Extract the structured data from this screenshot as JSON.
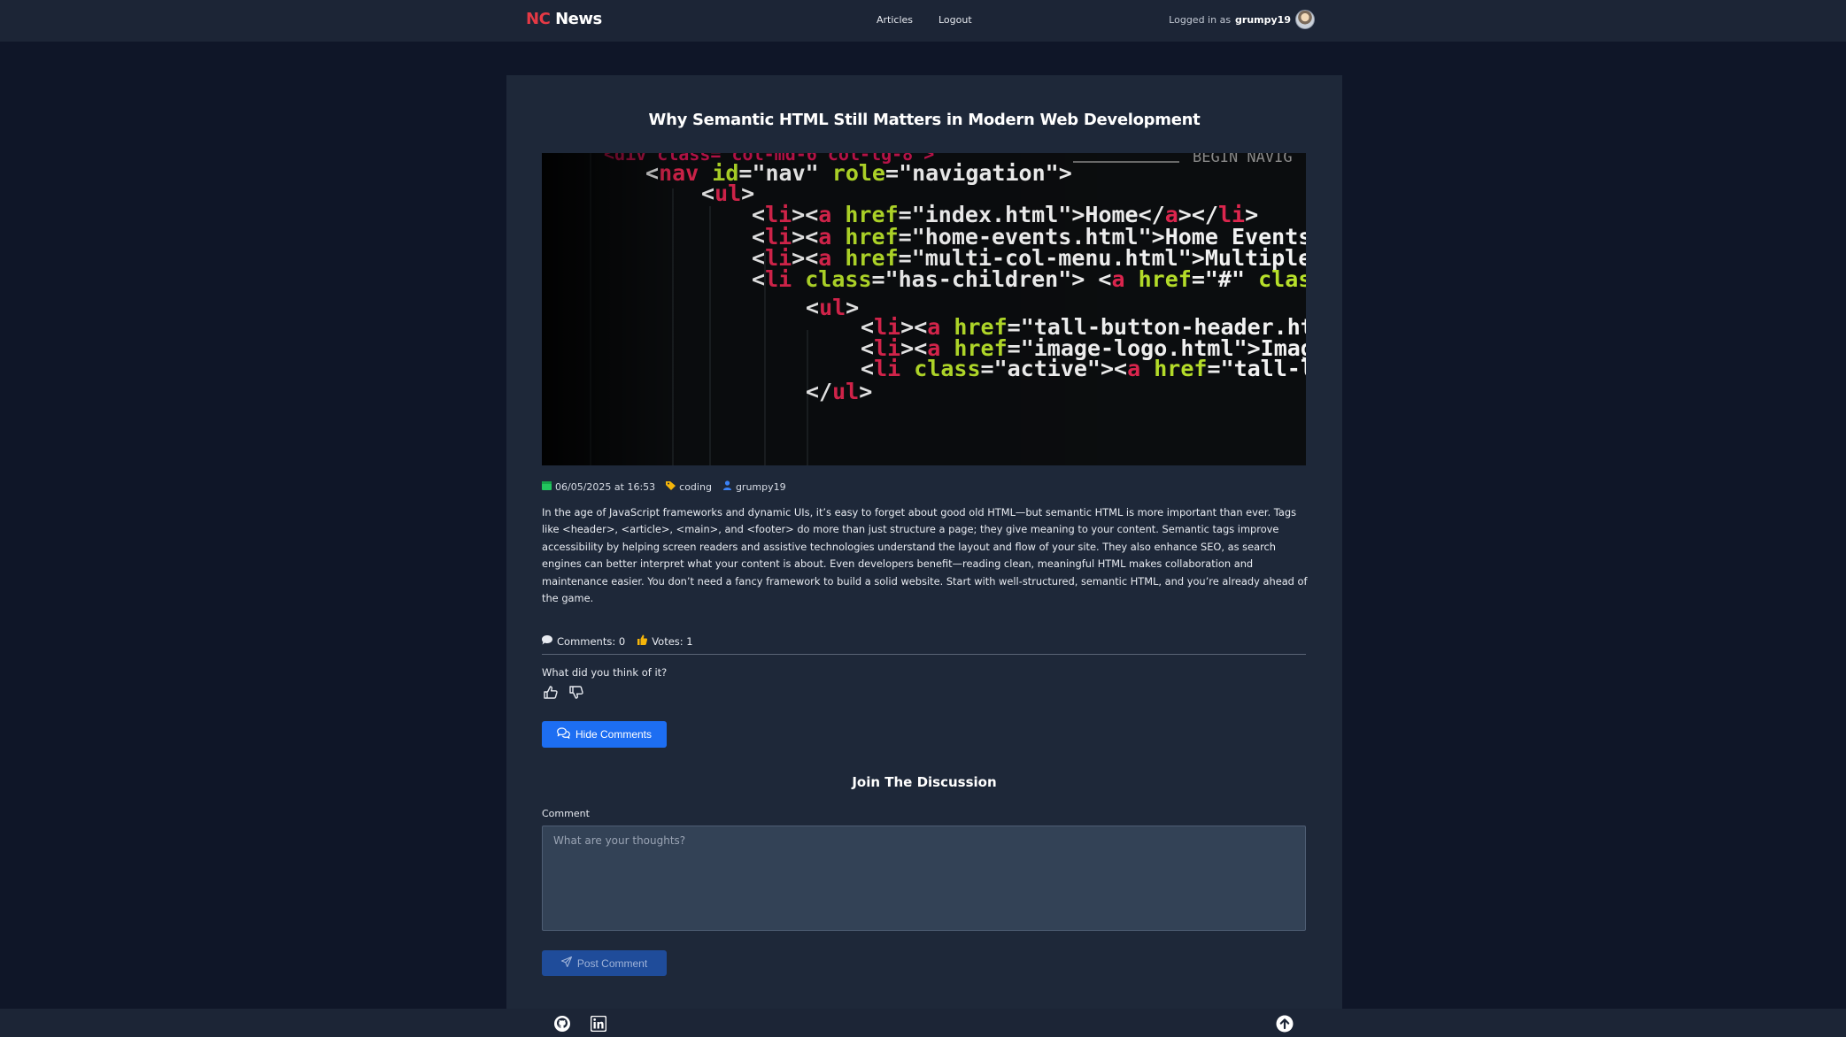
{
  "header": {
    "logo_nc": "NC",
    "logo_news": "News",
    "nav": {
      "articles": "Articles",
      "logout": "Logout"
    },
    "logged_prefix": "Logged in as",
    "username": "grumpy19",
    "avatar_icon": "user-avatar"
  },
  "article": {
    "title": "Why Semantic HTML Still Matters in Modern Web Development",
    "image_code_lines": [
      "<nav id=\"nav\" role=\"navigation\">",
      "<ul>",
      "<li><a href=\"index.html\">Home</a></li>",
      "<li><a href=\"home-events.html\">Home Events</a>",
      "<li><a href=\"multi-col-menu.html\">Multiple Col",
      "<li class=\"has-children\"> <a href=\"#\" class=\"cu",
      "<ul>",
      "<li><a href=\"tall-button-header.html\">T",
      "<li><a href=\"image-logo.html\">Image Log",
      "<li class=\"active\"><a href=\"tall-logo.h",
      "</ul>"
    ],
    "image_corner_text": "BEGIN NAVIG",
    "meta": {
      "date": "06/05/2025 at 16:53",
      "topic": "coding",
      "author": "grumpy19",
      "date_icon": "calendar-icon",
      "topic_icon": "tag-icon",
      "author_icon": "user-icon"
    },
    "body": "In the age of JavaScript frameworks and dynamic UIs, it’s easy to forget about good old HTML—but semantic HTML is more important than ever. Tags like <header>, <article>, <main>, and <footer> do more than just structure a page; they give meaning to your content. Semantic tags improve accessibility by helping screen readers and assistive technologies understand the layout and flow of your site. They also enhance SEO, as search engines can better interpret what your content is about. Even developers benefit—reading clean, meaningful HTML makes collaboration and maintenance easier. You don’t need a fancy framework to build a solid website. Start with well-structured, semantic HTML, and you’re already ahead of the game.",
    "comments_label": "Comments: 0",
    "votes_label": "Votes: 1",
    "vote_prompt": "What did you think of it?"
  },
  "actions": {
    "hide_comments": "Hide Comments",
    "join_title": "Join The Discussion",
    "comment_label": "Comment",
    "comment_placeholder": "What are your thoughts?",
    "comment_value": "",
    "post_comment": "Post Comment"
  },
  "colors": {
    "accent_red": "#e53945",
    "button_blue": "#1d6ef2",
    "button_disabled": "#1f4c9a",
    "background": "#0f1628",
    "card": "#1e2839"
  },
  "footer": {
    "icons": [
      "github-icon",
      "linkedin-icon",
      "scroll-to-top-icon"
    ]
  }
}
